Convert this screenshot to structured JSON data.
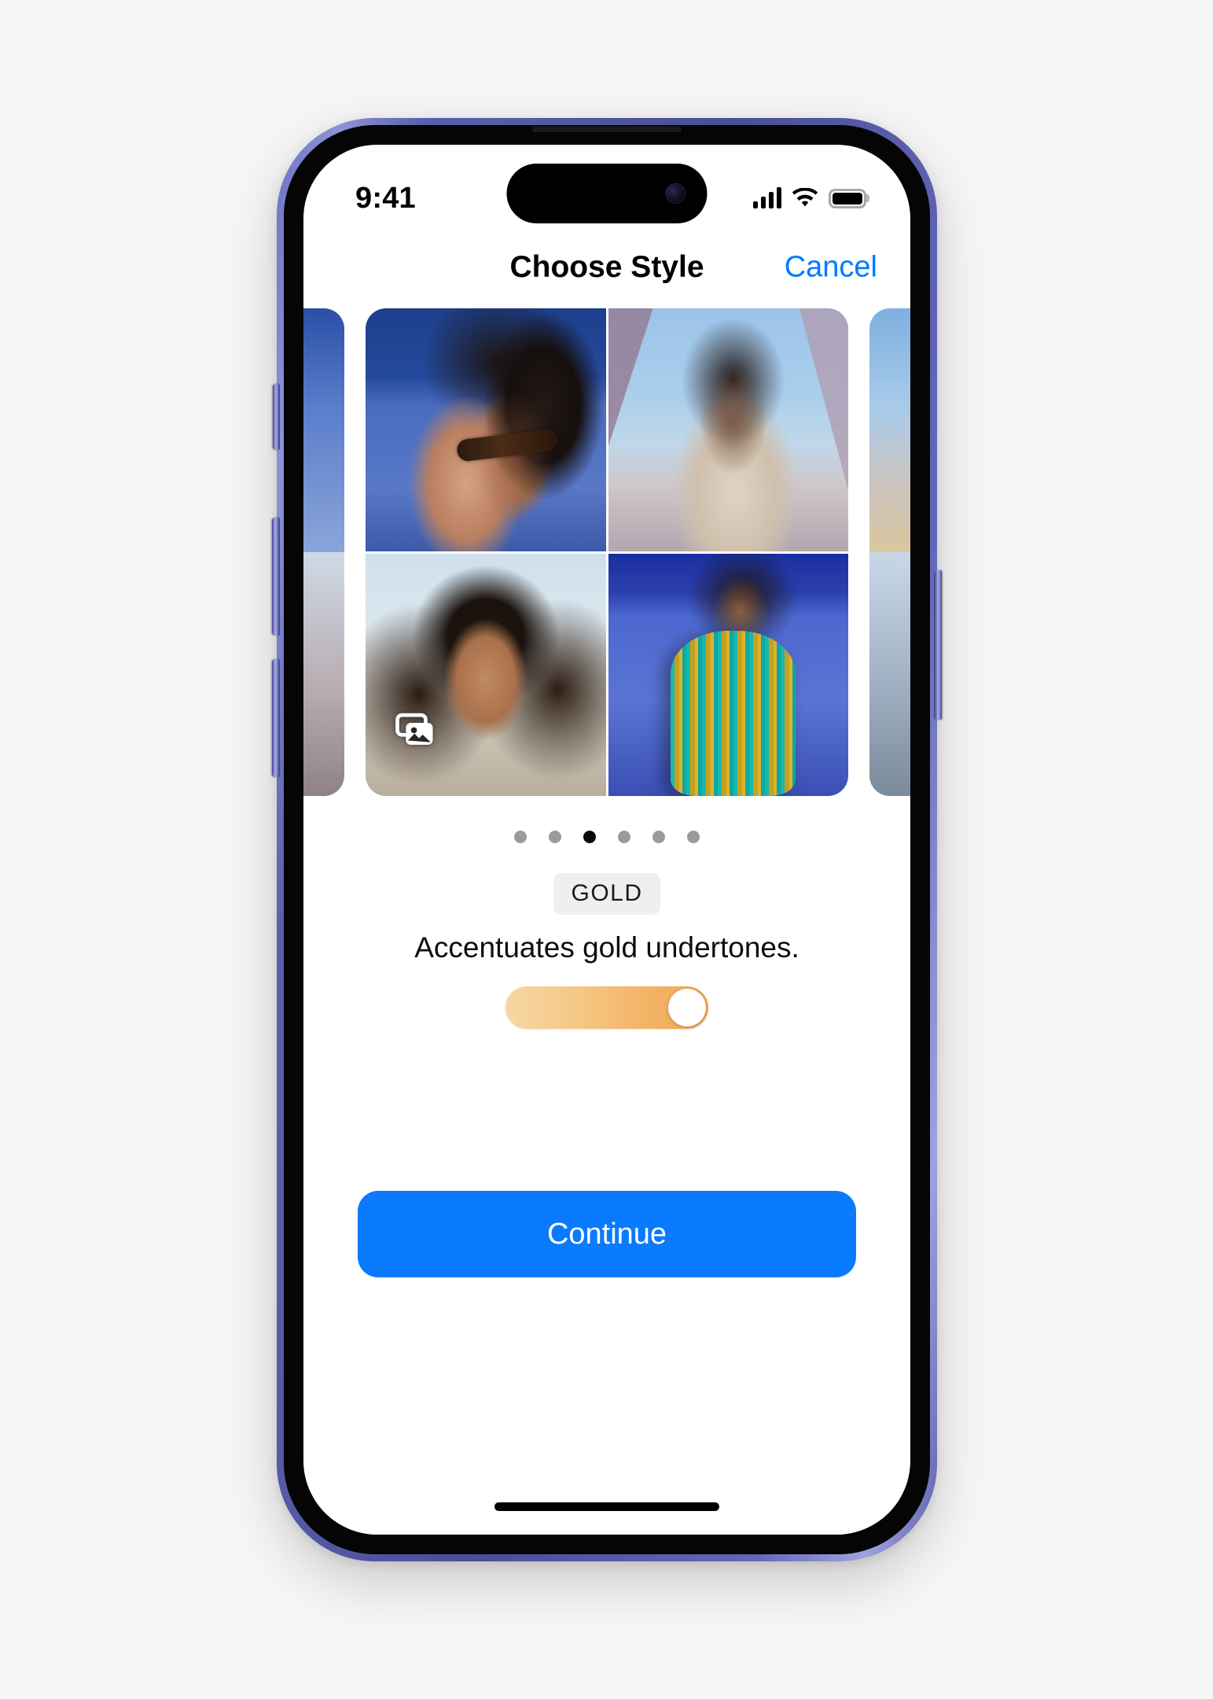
{
  "status_bar": {
    "time": "9:41",
    "signal_icon": "cellular-bars-icon",
    "signal_bars": 4,
    "wifi_icon": "wifi-icon",
    "battery_icon": "battery-full-icon",
    "battery_level": 100
  },
  "nav": {
    "title": "Choose Style",
    "cancel_label": "Cancel"
  },
  "carousel": {
    "current_index": 2,
    "total_pages": 6,
    "overlay_icon": "photo-stack-icon",
    "tiles": [
      {
        "name": "photo-sunglasses",
        "alt": "Person adjusting sunglasses against blue wall"
      },
      {
        "name": "photo-sky",
        "alt": "Person smiling in cream knit dress under blue sky"
      },
      {
        "name": "photo-portrait",
        "alt": "Close-up portrait with curly hair"
      },
      {
        "name": "photo-stripes",
        "alt": "Person in teal and gold striped dress on blue wall"
      }
    ]
  },
  "style_info": {
    "badge": "GOLD",
    "description": "Accentuates gold undertones."
  },
  "slider": {
    "name": "tone-intensity-slider",
    "value": 100,
    "min": 0,
    "max": 100,
    "track_start_color": "#F7D7A4",
    "track_end_color": "#EFA851"
  },
  "actions": {
    "continue_label": "Continue",
    "continue_color": "#0A7AFF"
  },
  "device": {
    "frame_color": "#5B5FAE",
    "home_indicator": "home-indicator"
  }
}
